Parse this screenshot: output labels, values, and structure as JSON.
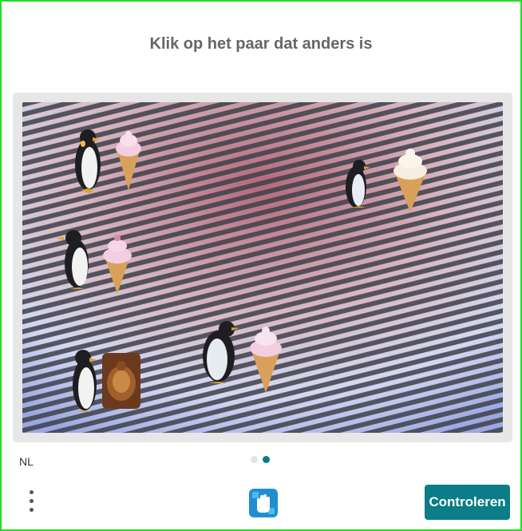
{
  "challenge": {
    "prompt": "Klik op het paar dat anders is",
    "pairs": [
      {
        "id": "pair-1",
        "items": [
          "penguin",
          "ice-cream-cone"
        ]
      },
      {
        "id": "pair-2",
        "items": [
          "penguin",
          "ice-cream-cone"
        ]
      },
      {
        "id": "pair-3",
        "items": [
          "penguin",
          "ice-cream-cone"
        ]
      },
      {
        "id": "pair-4",
        "items": [
          "penguin",
          "ice-cream-cone"
        ]
      },
      {
        "id": "pair-5",
        "items": [
          "penguin",
          "turkey"
        ]
      }
    ]
  },
  "footer": {
    "language": "NL",
    "pager_total": 2,
    "pager_active": 2,
    "submit_label": "Controleren",
    "menu_icon": "kebab-menu-icon",
    "logo_icon": "hand-logo-icon"
  },
  "colors": {
    "accent": "#0a7d86",
    "frame": "#22dd22",
    "prompt": "#666666"
  }
}
